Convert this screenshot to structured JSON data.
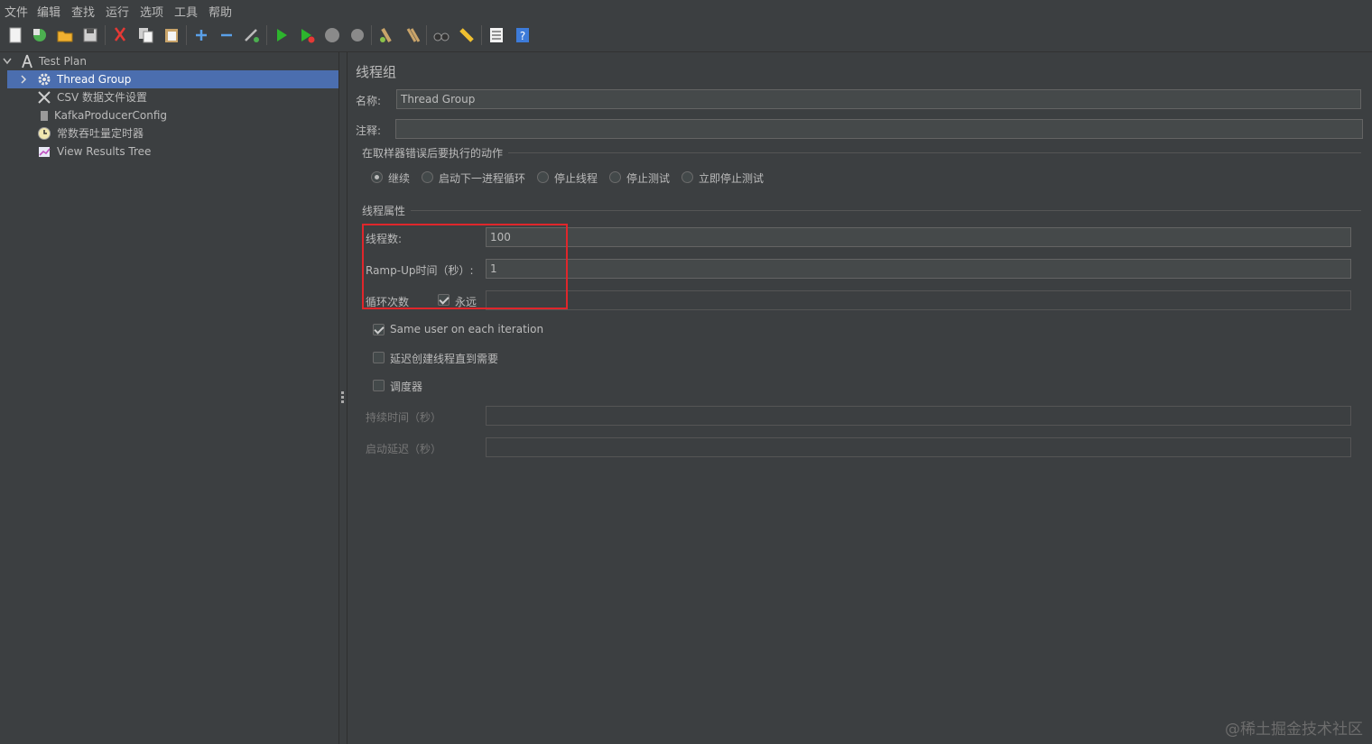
{
  "menu": [
    "文件",
    "编辑",
    "查找",
    "运行",
    "选项",
    "工具",
    "帮助"
  ],
  "toolbar_icons": [
    "new-icon",
    "templates-icon",
    "open-icon",
    "save-icon",
    "cut-icon",
    "copy-icon",
    "paste-icon",
    "expand-icon",
    "collapse-icon",
    "toggle-icon",
    "start-icon",
    "start-no-pause-icon",
    "stop-icon",
    "shutdown-icon",
    "clear-icon",
    "clear-all-icon",
    "search-icon",
    "reset-search-icon",
    "function-helper-icon",
    "help-icon"
  ],
  "tree": {
    "root": "Test Plan",
    "items": [
      "Thread Group",
      "CSV 数据文件设置",
      "KafkaProducerConfig",
      "常数吞吐量定时器",
      "View Results Tree"
    ]
  },
  "panel": {
    "title": "线程组",
    "name_label": "名称:",
    "name_value": "Thread Group",
    "comment_label": "注释:",
    "comment_value": "",
    "error_section": "在取样器错误后要执行的动作",
    "error_options": [
      "继续",
      "启动下一进程循环",
      "停止线程",
      "停止测试",
      "立即停止测试"
    ],
    "props_section": "线程属性",
    "threads_label": "线程数:",
    "threads_value": "100",
    "rampup_label": "Ramp-Up时间（秒）:",
    "rampup_value": "1",
    "loop_label": "循环次数",
    "forever_label": "永远",
    "loop_value": "",
    "same_user_label": "Same user on each iteration",
    "delay_label": "延迟创建线程直到需要",
    "scheduler_label": "调度器",
    "duration_label": "持续时间（秒）",
    "startup_delay_label": "启动延迟（秒）"
  },
  "watermark": "@稀土掘金技术社区",
  "colors": {
    "selection": "#4b6eaf",
    "highlight_box": "#e0262b",
    "background": "#3c3f41"
  }
}
